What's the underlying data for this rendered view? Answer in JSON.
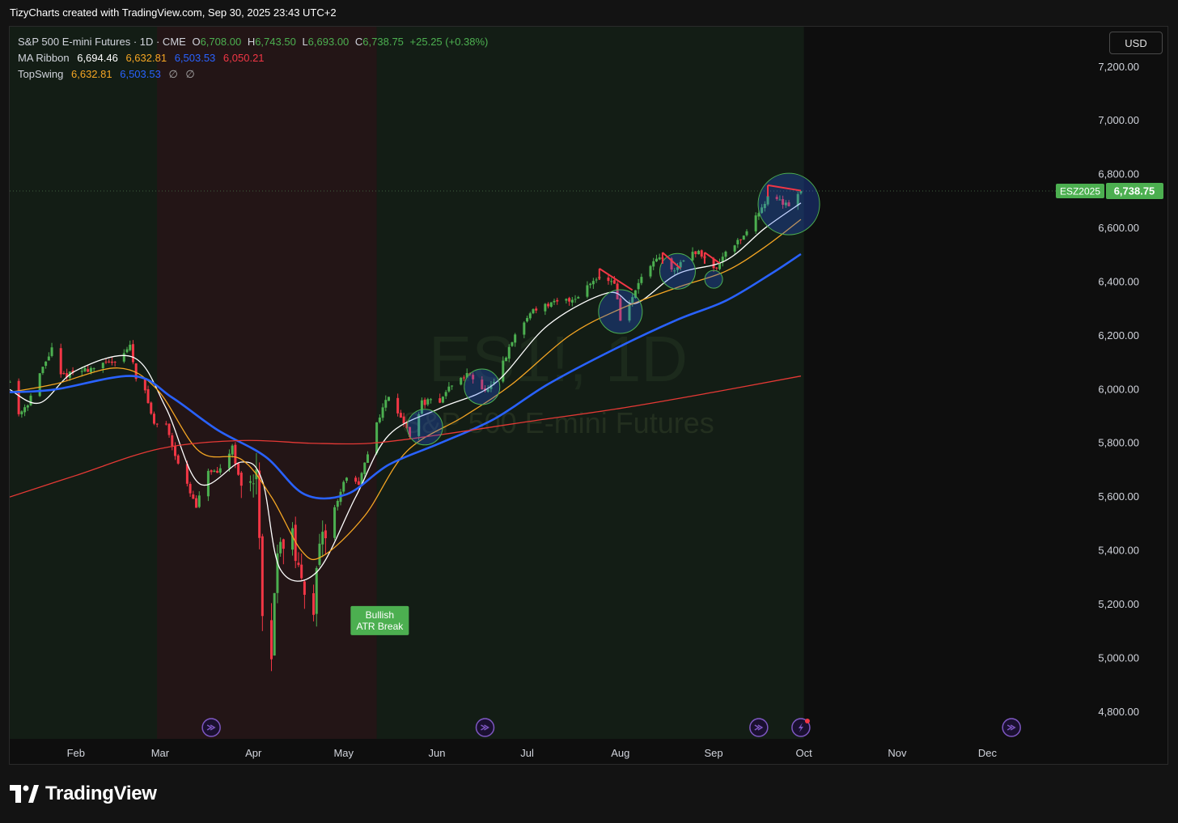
{
  "header": {
    "caption": "TizyCharts created with TradingView.com, Sep 30, 2025 23:43 UTC+2"
  },
  "legend": {
    "symbol": {
      "name": "S&P 500 E-mini Futures · 1D · CME",
      "o_label": "O",
      "o": "6,708.00",
      "h_label": "H",
      "h": "6,743.50",
      "l_label": "L",
      "l": "6,693.00",
      "c_label": "C",
      "c": "6,738.75",
      "change": "+25.25 (+0.38%)"
    },
    "ma_ribbon": {
      "name": "MA Ribbon",
      "v1": "6,694.46",
      "v2": "6,632.81",
      "v3": "6,503.53",
      "v4": "6,050.21"
    },
    "topswing": {
      "name": "TopSwing",
      "v1": "6,632.81",
      "v2": "6,503.53",
      "v3": "∅",
      "v4": "∅"
    }
  },
  "toolbar": {
    "currency": "USD"
  },
  "footer": {
    "brand": "TradingView"
  },
  "colors": {
    "up": "#4caf50",
    "down": "#f23645",
    "ma_fast": "#ffffff",
    "ma_orange": "#f5a623",
    "ma_blue": "#2962ff",
    "ma_red": "#e53935",
    "bg_green": "#131d15",
    "bg_red": "#231516",
    "price_tag": "#4caf50",
    "event_icon": "#7e57c2"
  },
  "chart_data": {
    "type": "candlestick",
    "symbol_label": "ESZ2025",
    "last_price": 6738.75,
    "last_price_label": "6,738.75",
    "watermark": {
      "main": "ES1!, 1D",
      "sub": "S&P 500 E-mini Futures"
    },
    "ylim": [
      4700,
      7350
    ],
    "y_ticks": [
      4800,
      5000,
      5200,
      5400,
      5600,
      5800,
      6000,
      6200,
      6400,
      6600,
      6800,
      7000,
      7200
    ],
    "y_tick_labels": [
      "4,800.00",
      "5,000.00",
      "5,200.00",
      "5,400.00",
      "5,600.00",
      "5,800.00",
      "6,000.00",
      "6,200.00",
      "6,400.00",
      "6,600.00",
      "6,800.00",
      "7,000.00",
      "7,200.00"
    ],
    "x_range": [
      "2025-01-10",
      "2025-12-31"
    ],
    "x_ticks": [
      {
        "date": "2025-02-01",
        "label": "Feb"
      },
      {
        "date": "2025-03-01",
        "label": "Mar"
      },
      {
        "date": "2025-04-01",
        "label": "Apr"
      },
      {
        "date": "2025-05-01",
        "label": "May"
      },
      {
        "date": "2025-06-01",
        "label": "Jun"
      },
      {
        "date": "2025-07-01",
        "label": "Jul"
      },
      {
        "date": "2025-08-01",
        "label": "Aug"
      },
      {
        "date": "2025-09-01",
        "label": "Sep"
      },
      {
        "date": "2025-10-01",
        "label": "Oct"
      },
      {
        "date": "2025-11-01",
        "label": "Nov"
      },
      {
        "date": "2025-12-01",
        "label": "Dec"
      }
    ],
    "regimes": [
      {
        "start": "2025-01-10",
        "end": "2025-02-28",
        "state": "bullish"
      },
      {
        "start": "2025-02-28",
        "end": "2025-05-12",
        "state": "bearish"
      },
      {
        "start": "2025-05-12",
        "end": "2025-09-30",
        "state": "bullish"
      }
    ],
    "price_path": [
      [
        "2025-01-10",
        6030
      ],
      [
        "2025-01-13",
        5910
      ],
      [
        "2025-01-16",
        5950
      ],
      [
        "2025-01-21",
        6080
      ],
      [
        "2025-01-24",
        6150
      ],
      [
        "2025-01-27",
        6050
      ],
      [
        "2025-02-03",
        6070
      ],
      [
        "2025-02-10",
        6090
      ],
      [
        "2025-02-14",
        6110
      ],
      [
        "2025-02-19",
        6160
      ],
      [
        "2025-02-21",
        6050
      ],
      [
        "2025-02-24",
        5990
      ],
      [
        "2025-02-27",
        5870
      ],
      [
        "2025-03-03",
        5870
      ],
      [
        "2025-03-06",
        5760
      ],
      [
        "2025-03-10",
        5640
      ],
      [
        "2025-03-13",
        5560
      ],
      [
        "2025-03-17",
        5700
      ],
      [
        "2025-03-20",
        5680
      ],
      [
        "2025-03-25",
        5790
      ],
      [
        "2025-03-28",
        5620
      ],
      [
        "2025-04-02",
        5700
      ],
      [
        "2025-04-04",
        5130
      ],
      [
        "2025-04-07",
        5010
      ],
      [
        "2025-04-09",
        5430
      ],
      [
        "2025-04-14",
        5450
      ],
      [
        "2025-04-16",
        5310
      ],
      [
        "2025-04-21",
        5200
      ],
      [
        "2025-04-23",
        5400
      ],
      [
        "2025-04-28",
        5560
      ],
      [
        "2025-05-02",
        5680
      ],
      [
        "2025-05-06",
        5640
      ],
      [
        "2025-05-12",
        5880
      ],
      [
        "2025-05-16",
        5980
      ],
      [
        "2025-05-21",
        5880
      ],
      [
        "2025-05-23",
        5820
      ],
      [
        "2025-05-27",
        5950
      ],
      [
        "2025-06-02",
        5960
      ],
      [
        "2025-06-06",
        6020
      ],
      [
        "2025-06-12",
        6060
      ],
      [
        "2025-06-17",
        5990
      ],
      [
        "2025-06-20",
        6020
      ],
      [
        "2025-06-27",
        6200
      ],
      [
        "2025-07-03",
        6300
      ],
      [
        "2025-07-10",
        6320
      ],
      [
        "2025-07-17",
        6340
      ],
      [
        "2025-07-24",
        6420
      ],
      [
        "2025-07-30",
        6400
      ],
      [
        "2025-08-01",
        6260
      ],
      [
        "2025-08-05",
        6340
      ],
      [
        "2025-08-08",
        6420
      ],
      [
        "2025-08-14",
        6490
      ],
      [
        "2025-08-19",
        6440
      ],
      [
        "2025-08-22",
        6490
      ],
      [
        "2025-08-27",
        6510
      ],
      [
        "2025-09-02",
        6450
      ],
      [
        "2025-09-05",
        6520
      ],
      [
        "2025-09-10",
        6560
      ],
      [
        "2025-09-15",
        6640
      ],
      [
        "2025-09-19",
        6720
      ],
      [
        "2025-09-23",
        6700
      ],
      [
        "2025-09-26",
        6690
      ],
      [
        "2025-09-30",
        6739
      ]
    ],
    "series": [
      {
        "name": "MA Ribbon",
        "values_label": "6,694.46",
        "color": "#ffffff",
        "points": [
          [
            "2025-01-10",
            6000
          ],
          [
            "2025-01-20",
            5950
          ],
          [
            "2025-02-01",
            6070
          ],
          [
            "2025-02-20",
            6120
          ],
          [
            "2025-03-03",
            5930
          ],
          [
            "2025-03-14",
            5650
          ],
          [
            "2025-03-28",
            5730
          ],
          [
            "2025-04-04",
            5660
          ],
          [
            "2025-04-10",
            5330
          ],
          [
            "2025-04-22",
            5320
          ],
          [
            "2025-05-05",
            5600
          ],
          [
            "2025-05-16",
            5830
          ],
          [
            "2025-06-02",
            5930
          ],
          [
            "2025-06-20",
            6020
          ],
          [
            "2025-07-08",
            6240
          ],
          [
            "2025-07-28",
            6360
          ],
          [
            "2025-08-06",
            6320
          ],
          [
            "2025-08-20",
            6430
          ],
          [
            "2025-09-05",
            6480
          ],
          [
            "2025-09-18",
            6600
          ],
          [
            "2025-09-30",
            6694
          ]
        ]
      },
      {
        "name": "MA Ribbon",
        "values_label": "6,632.81",
        "color": "#f5a623",
        "points": [
          [
            "2025-01-10",
            5990
          ],
          [
            "2025-01-25",
            6020
          ],
          [
            "2025-02-15",
            6080
          ],
          [
            "2025-02-28",
            6000
          ],
          [
            "2025-03-14",
            5770
          ],
          [
            "2025-03-28",
            5740
          ],
          [
            "2025-04-07",
            5600
          ],
          [
            "2025-04-17",
            5400
          ],
          [
            "2025-04-24",
            5380
          ],
          [
            "2025-05-08",
            5530
          ],
          [
            "2025-05-22",
            5770
          ],
          [
            "2025-06-10",
            5900
          ],
          [
            "2025-06-26",
            6020
          ],
          [
            "2025-07-15",
            6200
          ],
          [
            "2025-08-01",
            6300
          ],
          [
            "2025-08-20",
            6380
          ],
          [
            "2025-09-05",
            6440
          ],
          [
            "2025-09-18",
            6530
          ],
          [
            "2025-09-30",
            6633
          ]
        ]
      },
      {
        "name": "TopSwing",
        "values_label": "6,503.53",
        "color": "#2962ff",
        "points": [
          [
            "2025-01-10",
            5990
          ],
          [
            "2025-01-25",
            6000
          ],
          [
            "2025-02-20",
            6050
          ],
          [
            "2025-03-05",
            5970
          ],
          [
            "2025-03-20",
            5850
          ],
          [
            "2025-04-05",
            5750
          ],
          [
            "2025-04-18",
            5610
          ],
          [
            "2025-05-02",
            5610
          ],
          [
            "2025-05-16",
            5720
          ],
          [
            "2025-06-02",
            5800
          ],
          [
            "2025-06-20",
            5890
          ],
          [
            "2025-07-08",
            6020
          ],
          [
            "2025-07-30",
            6150
          ],
          [
            "2025-08-20",
            6260
          ],
          [
            "2025-09-05",
            6330
          ],
          [
            "2025-09-20",
            6430
          ],
          [
            "2025-09-30",
            6504
          ]
        ]
      },
      {
        "name": "MA Ribbon",
        "values_label": "6,050.21",
        "color": "#e53935",
        "points": [
          [
            "2025-01-10",
            5600
          ],
          [
            "2025-02-01",
            5680
          ],
          [
            "2025-03-01",
            5780
          ],
          [
            "2025-03-28",
            5810
          ],
          [
            "2025-04-20",
            5800
          ],
          [
            "2025-05-10",
            5800
          ],
          [
            "2025-06-01",
            5830
          ],
          [
            "2025-07-01",
            5880
          ],
          [
            "2025-08-01",
            5930
          ],
          [
            "2025-09-01",
            5990
          ],
          [
            "2025-09-30",
            6050
          ]
        ]
      }
    ],
    "annotations": [
      {
        "type": "label",
        "date": "2025-05-13",
        "price": 5170,
        "lines": [
          "Bullish",
          "ATR Break"
        ]
      },
      {
        "type": "circle",
        "date": "2025-05-28",
        "price": 5860
      },
      {
        "type": "circle",
        "date": "2025-06-16",
        "price": 6010
      },
      {
        "type": "circle",
        "date": "2025-08-01",
        "price": 6290
      },
      {
        "type": "circle",
        "date": "2025-08-20",
        "price": 6440
      },
      {
        "type": "circle",
        "date": "2025-09-01",
        "price": 6410
      },
      {
        "type": "circle",
        "date": "2025-09-26",
        "price": 6690
      },
      {
        "type": "trendline",
        "from": [
          "2025-07-25",
          6450
        ],
        "to": [
          "2025-08-05",
          6370
        ]
      },
      {
        "type": "trendline",
        "from": [
          "2025-08-15",
          6510
        ],
        "to": [
          "2025-08-21",
          6450
        ]
      },
      {
        "type": "trendline",
        "from": [
          "2025-08-29",
          6510
        ],
        "to": [
          "2025-09-03",
          6470
        ]
      },
      {
        "type": "trendline",
        "from": [
          "2025-09-19",
          6760
        ],
        "to": [
          "2025-09-30",
          6740
        ]
      }
    ],
    "events": [
      {
        "date": "2025-03-18",
        "kind": "economic"
      },
      {
        "date": "2025-06-17",
        "kind": "economic"
      },
      {
        "date": "2025-09-16",
        "kind": "economic"
      },
      {
        "date": "2025-09-30",
        "kind": "flash"
      },
      {
        "date": "2025-12-09",
        "kind": "economic"
      }
    ]
  }
}
